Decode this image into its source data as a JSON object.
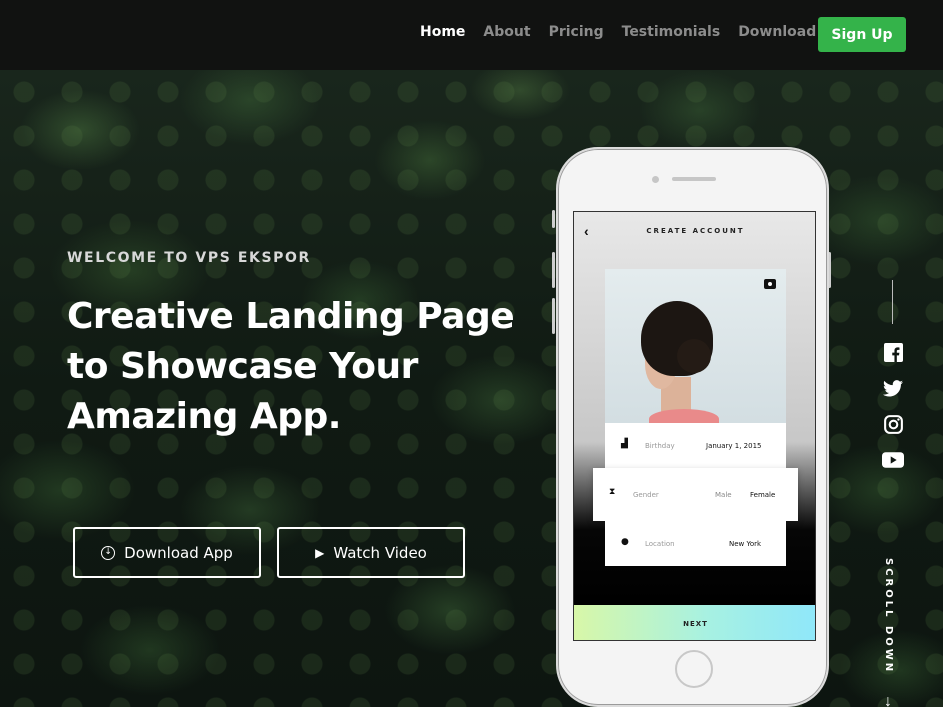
{
  "nav": {
    "links": [
      {
        "label": "Home",
        "active": true
      },
      {
        "label": "About",
        "active": false
      },
      {
        "label": "Pricing",
        "active": false
      },
      {
        "label": "Testimonials",
        "active": false
      },
      {
        "label": "Download",
        "active": false
      }
    ],
    "signup_label": "Sign Up"
  },
  "hero": {
    "welcome": "WELCOME TO VPS EKSPOR",
    "headline_line1": "Creative Landing Page",
    "headline_line2": "to Showcase Your",
    "headline_line3": "Amazing App.",
    "download_label": "Download App",
    "video_label": "Watch Video"
  },
  "phone": {
    "screen_title": "CREATE ACCOUNT",
    "birthday_label": "Birthday",
    "birthday_value": "January 1, 2015",
    "gender_label": "Gender",
    "gender_option_male": "Male",
    "gender_option_female": "Female",
    "location_label": "Location",
    "location_value": "New York",
    "next_label": "NEXT"
  },
  "social": {
    "icons": [
      "facebook-icon",
      "twitter-icon",
      "instagram-icon",
      "youtube-icon"
    ],
    "scroll_label": "SCROLL DOWN"
  },
  "colors": {
    "nav_bg": "#111211",
    "signup_bg": "#34b34a",
    "next_gradient_start": "#d8f7a8",
    "next_gradient_end": "#8fe7fa"
  }
}
